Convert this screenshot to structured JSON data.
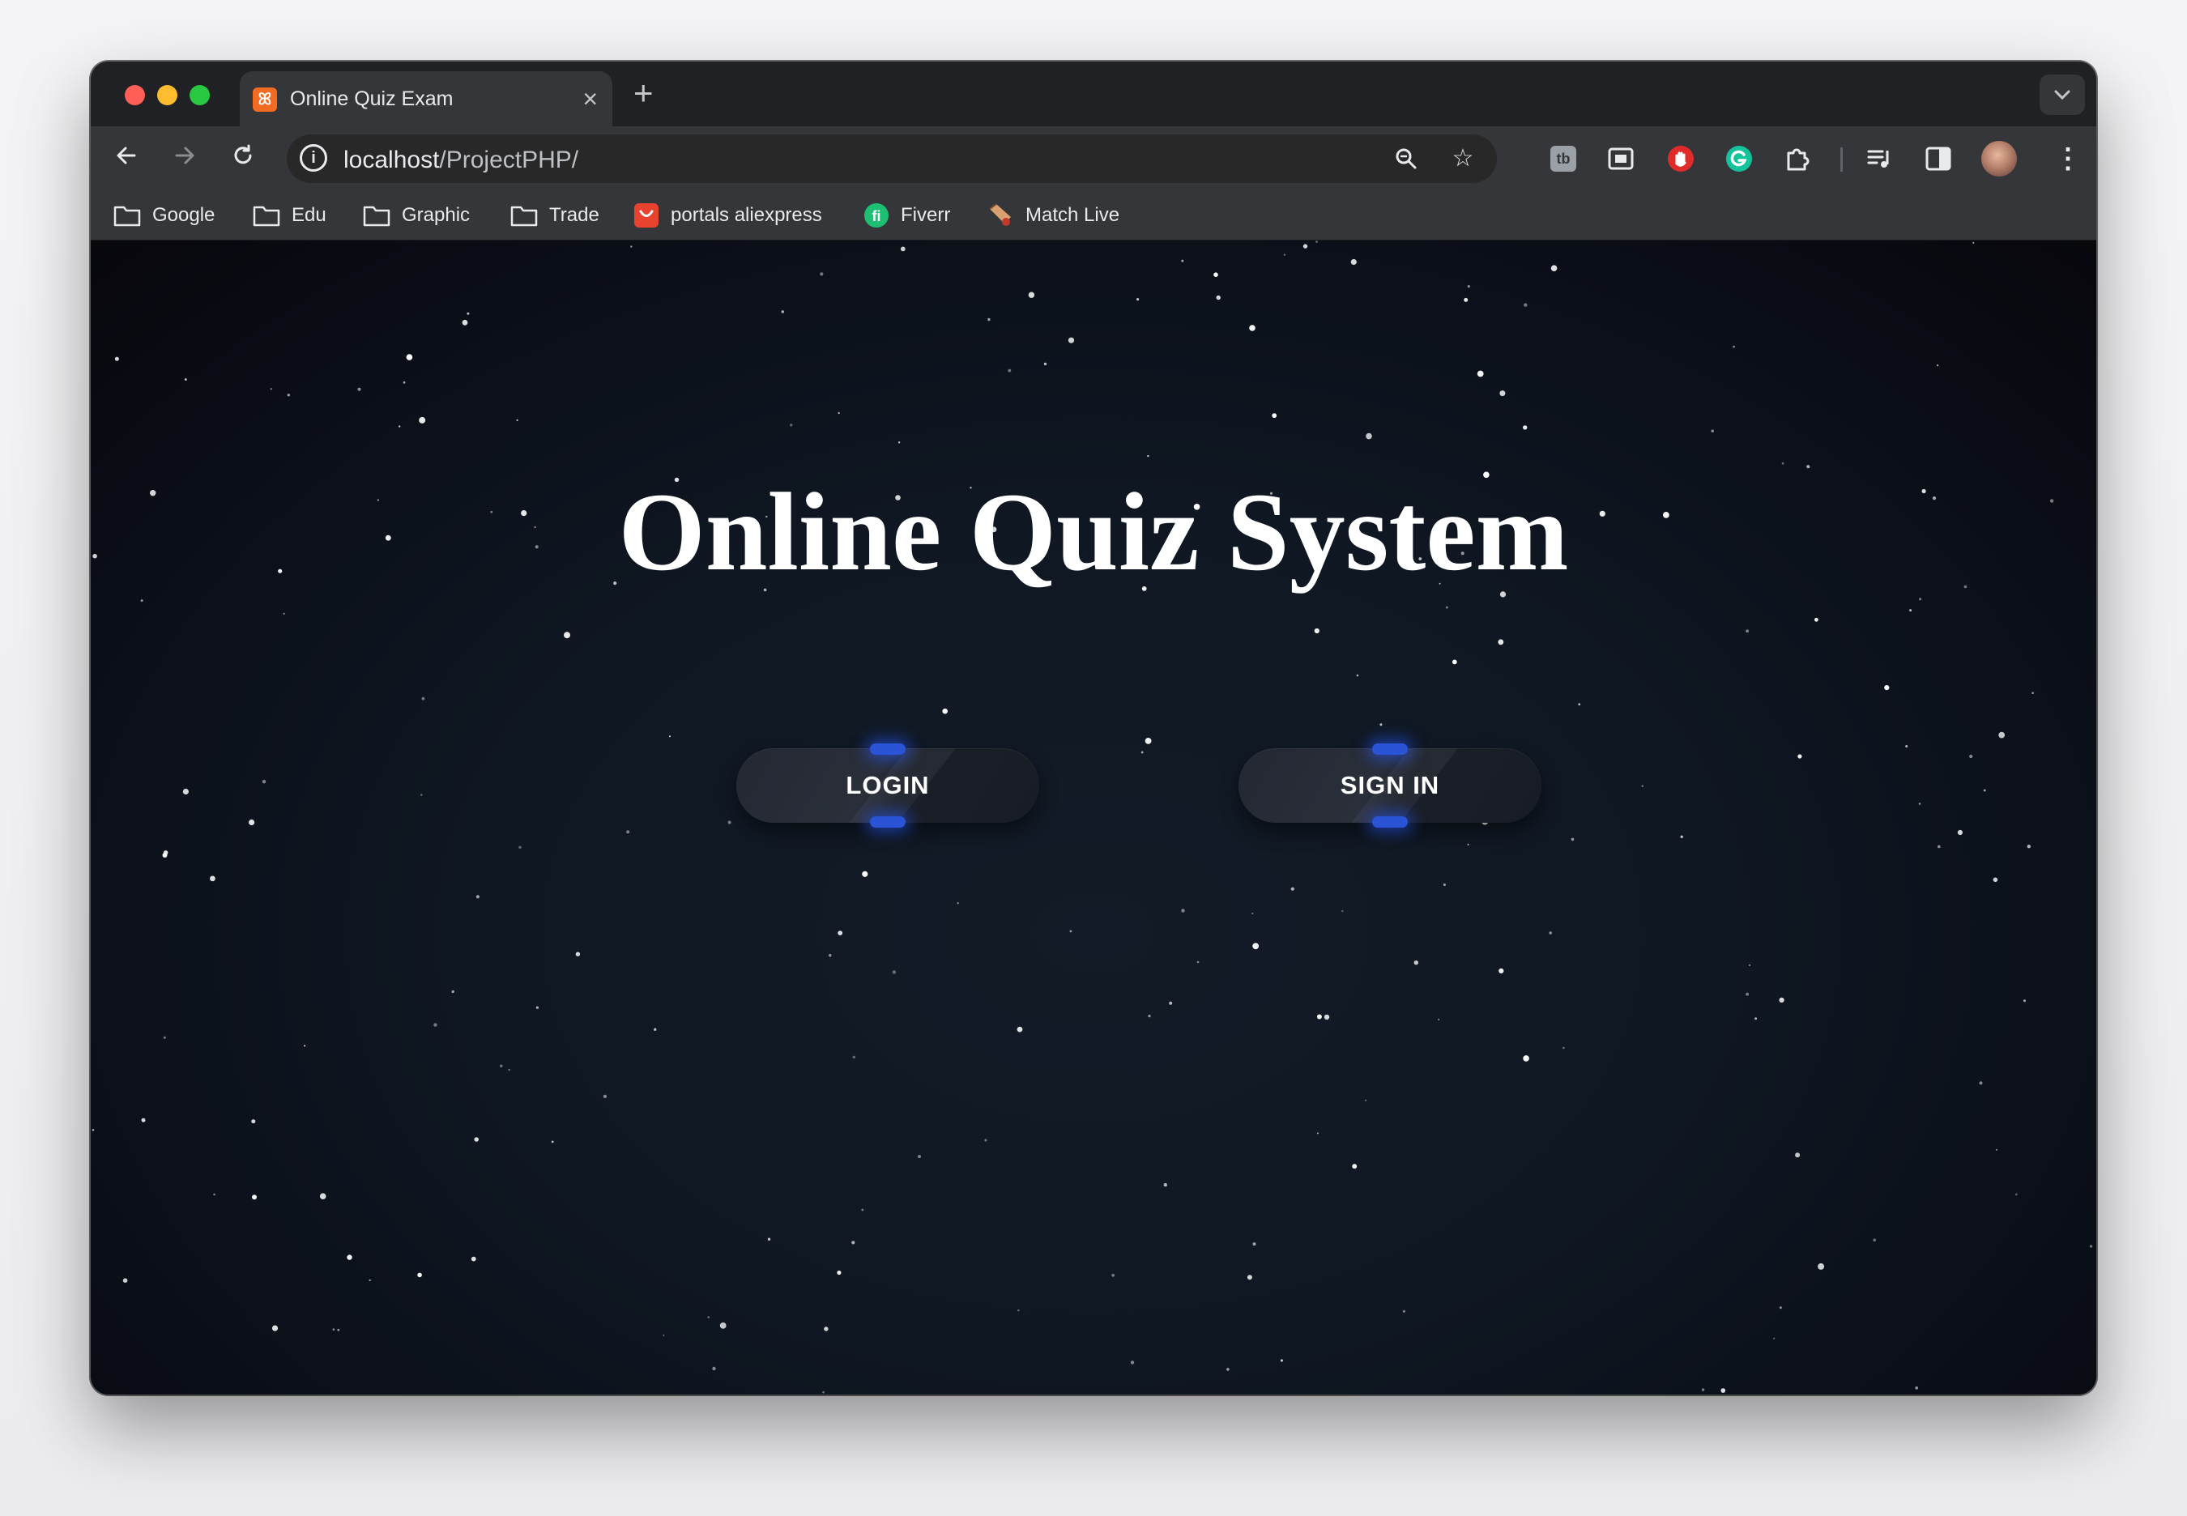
{
  "browser": {
    "tab": {
      "title": "Online Quiz Exam",
      "favicon_icon": "xampp-icon"
    },
    "new_tab_label": "+",
    "omnibox": {
      "host": "localhost",
      "path": "/ProjectPHP/"
    },
    "bookmarks": [
      {
        "label": "Google",
        "icon": "folder-icon"
      },
      {
        "label": "Edu",
        "icon": "folder-icon"
      },
      {
        "label": "Graphic",
        "icon": "folder-icon"
      },
      {
        "label": "Trade",
        "icon": "folder-icon"
      },
      {
        "label": "portals aliexpress",
        "icon": "aliexpress-icon"
      },
      {
        "label": "Fiverr",
        "icon": "fiverr-icon"
      },
      {
        "label": "Match Live",
        "icon": "match-live-icon"
      }
    ]
  },
  "page": {
    "title": "Online Quiz System",
    "login_label": "LOGIN",
    "signin_label": "SIGN IN",
    "accent_color": "#2b53d6",
    "background_color": "#0f1722"
  }
}
